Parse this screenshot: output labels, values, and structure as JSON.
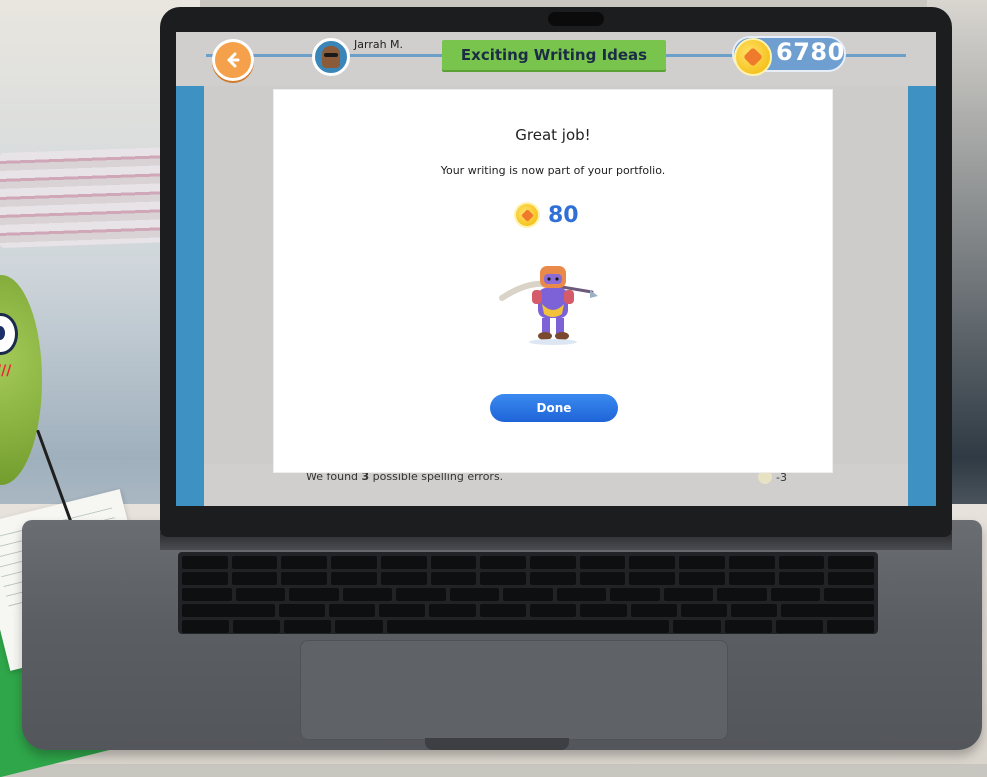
{
  "header": {
    "user_name": "Jarrah M.",
    "title": "Exciting Writing Ideas",
    "coin_total": "6780"
  },
  "modal": {
    "title": "Great job!",
    "subtitle": "Your writing is now part of your portfolio.",
    "reward_value": "80",
    "done_label": "Done"
  },
  "feedback": {
    "spelling_prefix": "We found ",
    "spelling_count": "3",
    "spelling_suffix": " possible spelling errors.",
    "penalty": "-3"
  },
  "icons": {
    "back": "back-arrow-icon",
    "avatar": "user-avatar-icon",
    "coin": "coin-icon",
    "character": "character-illustration"
  },
  "colors": {
    "banner": "#78c44c",
    "side_band": "#3d91c3",
    "done_button": "#2f77e6",
    "reward_text": "#2f6fd6"
  }
}
